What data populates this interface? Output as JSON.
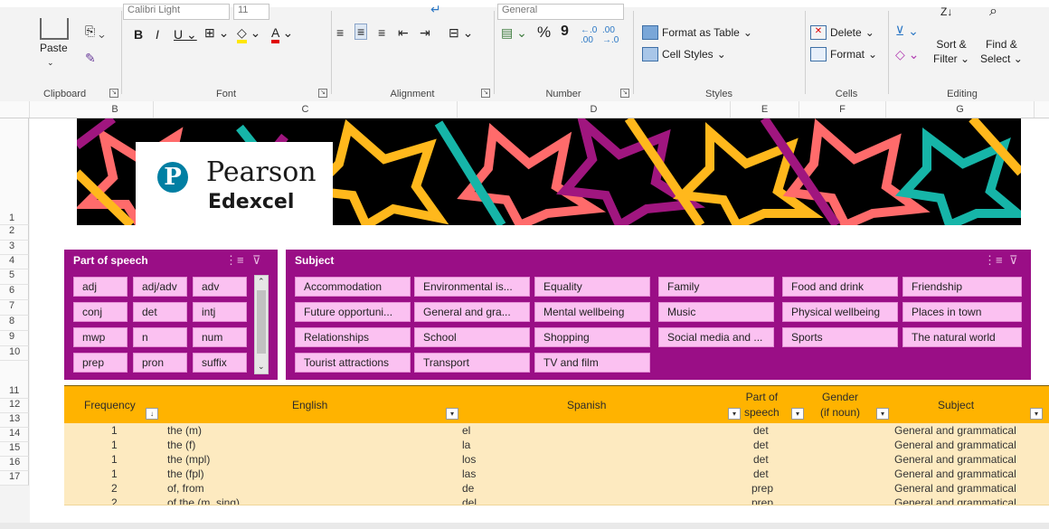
{
  "ribbon": {
    "clipboard": {
      "label": "Clipboard",
      "paste": "Paste"
    },
    "font": {
      "label": "Font",
      "font_name": "Calibri Light",
      "font_size": "11"
    },
    "alignment": {
      "label": "Alignment"
    },
    "number": {
      "label": "Number",
      "format": "General",
      "percent": "%",
      "comma": "9"
    },
    "styles": {
      "label": "Styles",
      "format_as_table": "Format as Table",
      "cell_styles": "Cell Styles"
    },
    "cells": {
      "label": "Cells",
      "delete": "Delete",
      "format": "Format"
    },
    "editing": {
      "label": "Editing",
      "sort_filter_1": "Sort &",
      "sort_filter_2": "Filter",
      "find_select_1": "Find &",
      "find_select_2": "Select"
    }
  },
  "columns": [
    "B",
    "C",
    "D",
    "E",
    "F",
    "G"
  ],
  "rows": [
    "1",
    "2",
    "3",
    "4",
    "5",
    "6",
    "7",
    "8",
    "9",
    "10",
    "11",
    "12",
    "13",
    "14",
    "15",
    "16",
    "17"
  ],
  "banner": {
    "brand": "Pearson",
    "sub": "Edexcel",
    "logo_letter": "P"
  },
  "slicer_pos": {
    "title": "Part of speech",
    "items": [
      "adj",
      "adj/adv",
      "adv",
      "conj",
      "det",
      "intj",
      "mwp",
      "n",
      "num",
      "prep",
      "pron",
      "suffix"
    ]
  },
  "slicer_subject": {
    "title": "Subject",
    "items": [
      "Accommodation",
      "Environmental is...",
      "Equality",
      "Family",
      "Food and drink",
      "Friendship",
      "Future opportuni...",
      "General and gra...",
      "Mental wellbeing",
      "Music",
      "Physical wellbeing",
      "Places in town",
      "Relationships",
      "School",
      "Shopping",
      "Social media and ...",
      "Sports",
      "The natural world",
      "Tourist attractions",
      "Transport",
      "TV and film"
    ]
  },
  "table": {
    "headers": {
      "frequency": "Frequency",
      "english": "English",
      "spanish": "Spanish",
      "pos_1": "Part of",
      "pos_2": "speech",
      "gender_1": "Gender",
      "gender_2": "(if noun)",
      "subject": "Subject"
    },
    "rows": [
      {
        "freq": "1",
        "english": "the (m)",
        "spanish": "el",
        "pos": "det",
        "subject": "General and grammatical"
      },
      {
        "freq": "1",
        "english": "the (f)",
        "spanish": "la",
        "pos": "det",
        "subject": "General and grammatical"
      },
      {
        "freq": "1",
        "english": "the (mpl)",
        "spanish": "los",
        "pos": "det",
        "subject": "General and grammatical"
      },
      {
        "freq": "1",
        "english": "the (fpl)",
        "spanish": "las",
        "pos": "det",
        "subject": "General and grammatical"
      },
      {
        "freq": "2",
        "english": "of, from",
        "spanish": "de",
        "pos": "prep",
        "subject": "General and grammatical"
      },
      {
        "freq": "2",
        "english": "of the (m, sing)",
        "spanish": "del",
        "pos": "prep",
        "subject": "General and grammatical"
      }
    ]
  },
  "colors": {
    "slicer": "#9a0e86",
    "chip": "#fbc1f1",
    "header": "#ffb300",
    "row": "#fdeac0"
  }
}
